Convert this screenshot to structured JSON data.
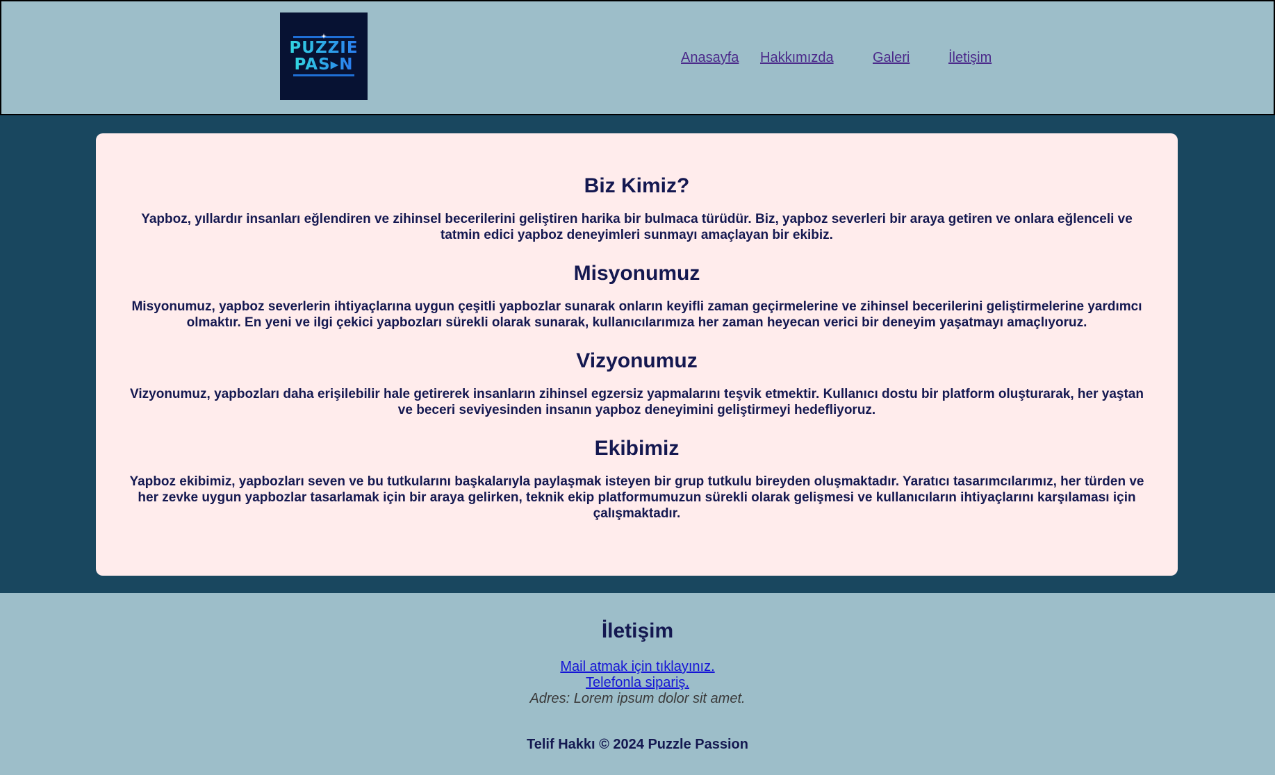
{
  "header": {
    "logo_lines": [
      "PUZZIE",
      "PAS",
      "N"
    ],
    "nav": [
      {
        "label": "Anasayfa"
      },
      {
        "label": "Hakkımızda"
      },
      {
        "label": "Galeri"
      },
      {
        "label": "İletişim"
      }
    ]
  },
  "main": {
    "sections": [
      {
        "heading": "Biz Kimiz?",
        "text": "Yapboz, yıllardır insanları eğlendiren ve zihinsel becerilerini geliştiren harika bir bulmaca türüdür. Biz, yapboz severleri bir araya getiren ve onlara eğlenceli ve tatmin edici yapboz deneyimleri sunmayı amaçlayan bir ekibiz."
      },
      {
        "heading": "Misyonumuz",
        "text": "Misyonumuz, yapboz severlerin ihtiyaçlarına uygun çeşitli yapbozlar sunarak onların keyifli zaman geçirmelerine ve zihinsel becerilerini geliştirmelerine yardımcı olmaktır. En yeni ve ilgi çekici yapbozları sürekli olarak sunarak, kullanıcılarımıza her zaman heyecan verici bir deneyim yaşatmayı amaçlıyoruz."
      },
      {
        "heading": "Vizyonumuz",
        "text": "Vizyonumuz, yapbozları daha erişilebilir hale getirerek insanların zihinsel egzersiz yapmalarını teşvik etmektir. Kullanıcı dostu bir platform oluşturarak, her yaştan ve beceri seviyesinden insanın yapboz deneyimini geliştirmeyi hedefliyoruz."
      },
      {
        "heading": "Ekibimiz",
        "text": "Yapboz ekibimiz, yapbozları seven ve bu tutkularını başkalarıyla paylaşmak isteyen bir grup tutkulu bireyden oluşmaktadır. Yaratıcı tasarımcılarımız, her türden ve her zevke uygun yapbozlar tasarlamak için bir araya gelirken, teknik ekip platformumuzun sürekli olarak gelişmesi ve kullanıcıların ihtiyaçlarını karşılaması için çalışmaktadır."
      }
    ]
  },
  "footer": {
    "title": "İletişim",
    "mail_link": "Mail atmak için tıklayınız.",
    "phone_link": "Telefonla sipariş.",
    "address": "Adres: Lorem ipsum dolor sit amet.",
    "copyright": "Telif Hakkı © 2024 Puzzle Passion"
  },
  "colors": {
    "header_bg": "#9dbec9",
    "page_bg": "#19475f",
    "card_bg": "#ffecec",
    "text": "#141850",
    "nav_link": "#4b2a8a",
    "footer_link": "#1414d6",
    "logo_bg": "#071233"
  }
}
